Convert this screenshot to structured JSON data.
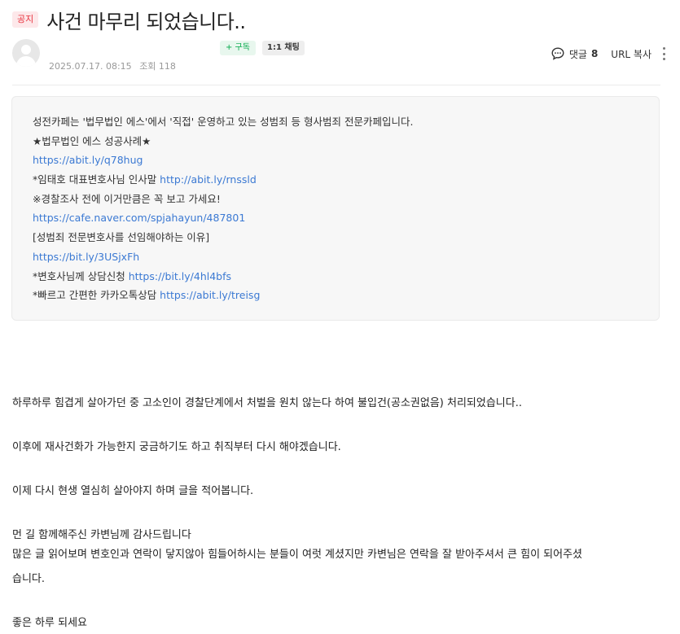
{
  "post": {
    "badge": "공지",
    "title": "사건 마무리 되었습니다..",
    "subscribe_label": "+ 구독",
    "chat_label": "1:1 채팅",
    "date": "2025.07.17. 08:15",
    "views_label": "조회 118",
    "comment_label": "댓글",
    "comment_count": "8",
    "url_copy_label": "URL 복사"
  },
  "intro": {
    "line1": "성전카페는 '법무법인 에스'에서 '직접' 운영하고 있는 성범죄 등 형사범죄 전문카페입니다.",
    "line2": "★법무법인 에스 성공사례★",
    "line3_link": "https://abit.ly/q78hug",
    "line4_text": "*임태호 대표변호사님 인사말 ",
    "line4_link": "http://abit.ly/rnssld",
    "line5": "※경찰조사 전에 이거만큼은 꼭 보고 가세요!",
    "line6_link": "https://cafe.naver.com/spjahayun/487801",
    "line7": "[성범죄 전문변호사를 선임해야하는 이유]",
    "line8_link": "https://bit.ly/3USjxFh",
    "line9_text": "*변호사님께 상담신청 ",
    "line9_link": "https://bit.ly/4hl4bfs",
    "line10_text": "*빠르고 간편한 카카오톡상담 ",
    "line10_link": "https://abit.ly/treisg"
  },
  "body": {
    "p1": "하루하루 힘겹게 살아가던 중 고소인이 경찰단계에서 처벌을 원치 않는다 하여 불입건(공소권없음) 처리되었습니다..",
    "p2": "이후에 재사건화가 가능한지 궁금하기도 하고 취직부터 다시 해야겠습니다.",
    "p3": "이제 다시 현생 열심히 살아야지 하며 글을 적어봅니다.",
    "p4": "먼 길 함께해주신 카변님께 감사드립니다",
    "p5a": "많은 글 읽어보며 변호인과 연락이 닿지않아 힘들어하시는 분들이 여럿 계셨지만 카변님은 연락을 잘 받아주셔서 큰 힘이 되어주셨",
    "p5b": "습니다.",
    "p6": "좋은 하루 되세요"
  },
  "colors": {
    "badge_text": "#e8343f",
    "badge_bg": "#fde8ea",
    "subscribe": "#03a94a",
    "link": "#3b79d3"
  },
  "icons": {
    "comment": "speech-bubble-icon",
    "more": "vertical-dots-icon",
    "avatar": "default-profile-icon"
  }
}
